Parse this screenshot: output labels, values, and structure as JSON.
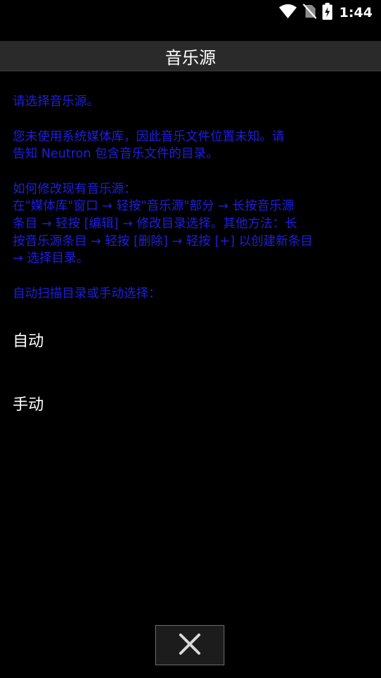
{
  "status_bar": {
    "time": "1:44",
    "icons": [
      "wifi-icon",
      "no-sim-icon",
      "battery-charging-icon"
    ]
  },
  "dialog": {
    "title": "音乐源",
    "messages": [
      "请选择音乐源。",
      "您未使用系统媒体库，因此音乐文件位置未知。请\n告知 Neutron 包含音乐文件的目录。",
      "如何修改现有音乐源：\n在\"媒体库\"窗口 → 轻按\"音乐源\"部分 → 长按音乐源\n条目 → 轻按 [编辑] → 修改目录选择。其他方法：长\n按音乐源条目 → 轻按 [删除] → 轻按 [+] 以创建新条目\n→ 选择目录。",
      "自动扫描目录或手动选择："
    ],
    "options": {
      "auto": "自动",
      "manual": "手动"
    },
    "close_icon": "close-icon"
  },
  "colors": {
    "background": "#000000",
    "title_bar": "#2a2a2a",
    "message_text": "#1e1ee0",
    "option_text": "#ffffff"
  }
}
